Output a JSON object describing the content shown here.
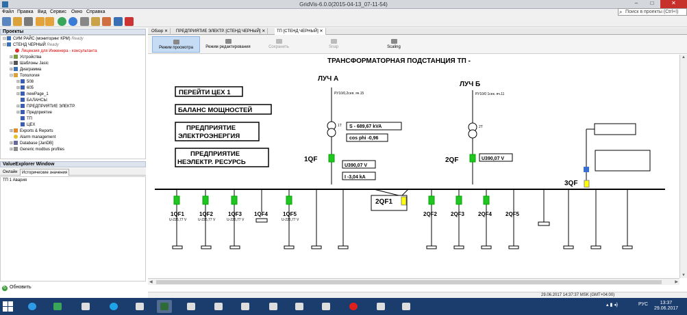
{
  "window": {
    "title": "GridVis-6.0.0(2015-04-13_07-11-54)",
    "min": "–",
    "max": "□",
    "close": "✕"
  },
  "menu": [
    "Файл",
    "Правка",
    "Вид",
    "Сервис",
    "Окно",
    "Справка"
  ],
  "search": {
    "placeholder": "Поиск в проекты (Ctrl+I)"
  },
  "projects_panel": {
    "title": "Проекты",
    "items": [
      {
        "label": "СИМ РАЙС (мониторинг КРМ)",
        "ready": "Ready",
        "level": 0,
        "color": "black"
      },
      {
        "label": "СТЕНД ЧЕРНЫЙ",
        "ready": "Ready",
        "level": 0,
        "color": "black"
      },
      {
        "label": "Лицензия для Инженера - консультанта",
        "ready": "",
        "level": 1,
        "color": "red"
      },
      {
        "label": "Устройства",
        "ready": "",
        "level": 1,
        "color": "black"
      },
      {
        "label": "Шаблоны Jasic",
        "ready": "",
        "level": 1,
        "color": "black"
      },
      {
        "label": "Диаграмма",
        "ready": "",
        "level": 1,
        "color": "black"
      },
      {
        "label": "Топология",
        "ready": "",
        "level": 1,
        "color": "black"
      },
      {
        "label": "508",
        "ready": "",
        "level": 2,
        "color": "black"
      },
      {
        "label": "605",
        "ready": "",
        "level": 2,
        "color": "black"
      },
      {
        "label": "newPage_1",
        "ready": "",
        "level": 2,
        "color": "black"
      },
      {
        "label": "БАЛАНСЫ",
        "ready": "",
        "level": 2,
        "color": "black"
      },
      {
        "label": "ПРЕДПРИЯТИЕ ЭЛЕКТР.",
        "ready": "",
        "level": 2,
        "color": "black"
      },
      {
        "label": "Предприятие",
        "ready": "",
        "level": 2,
        "color": "black"
      },
      {
        "label": "ТП",
        "ready": "",
        "level": 2,
        "color": "black"
      },
      {
        "label": "ЦЕХ",
        "ready": "",
        "level": 2,
        "color": "black"
      },
      {
        "label": "Exports & Reports",
        "ready": "",
        "level": 1,
        "color": "black"
      },
      {
        "label": "Alarm management",
        "ready": "",
        "level": 1,
        "color": "black"
      },
      {
        "label": "Database [JanDB]",
        "ready": "",
        "level": 1,
        "color": "black"
      },
      {
        "label": "Generic modbus profiles",
        "ready": "",
        "level": 1,
        "color": "black"
      }
    ]
  },
  "value_explorer": {
    "title": "ValueExplorer Window",
    "tabs": [
      "Онлайн",
      "Исторические значения"
    ],
    "row": "ТП 1 Авария",
    "refresh": "Обновить"
  },
  "doc_tabs": [
    "Обзор",
    "ПРЕДПРИЯТИЕ ЭЛЕКТР. [СТЕНД ЧЕРНЫЙ]",
    "ТП [СТЕНД ЧЕРНЫЙ]"
  ],
  "modes": [
    "Режим просмотра",
    "Режим редактирования",
    "Сохранить",
    "Snap",
    "Scaling"
  ],
  "diagram": {
    "title": "ТРАНСФОРМАТОРНАЯ ПОДСТАНЦИЯ ТП -",
    "links": [
      "ПЕРЕЙТИ ЦЕХ 1",
      "БАЛАНС МОЩНОСТЕЙ",
      "ПРЕДПРИЯТИЕ",
      "ЭЛЕКТРОЭНЕРГИЯ",
      "ПРЕДПРИЯТИЕ",
      "НЕЭЛЕКТР. РЕСУРСЬ"
    ],
    "luch_a": "ЛУЧ А",
    "luch_b": "ЛУЧ Б",
    "ru_a": "РУ10/0,2сея. яч.15",
    "ru_b": "РУ10/0 1сек. яч.11",
    "tr_a": "1Т",
    "tr_b": "2Т",
    "s_value": "S - 689,67 kVA",
    "cosphi": "cos phi -0,96",
    "qf1": "1QF",
    "qf2": "2QF",
    "qf3": "3QF",
    "u1": "U390,07 V",
    "u2": "U390,07 V",
    "i1": "I -3,04 kA",
    "sect": "2QF1",
    "feeders_left": [
      "1QF1",
      "1QF2",
      "1QF3",
      "1QF4",
      "1QF5"
    ],
    "feeders_left_u": [
      "U-226,77 V",
      "U-226,77 V",
      "U-226,77 V",
      "",
      "U-226,77 V"
    ],
    "feeders_right": [
      "2QF2",
      "2QF3",
      "2QF4",
      "2QF5"
    ]
  },
  "status": "29.06.2017 14:37:37 MSK (GMT+04:00)",
  "taskbar": {
    "lang": "РУС",
    "time": "13:37",
    "date": "29.06.2017"
  },
  "colors": {
    "accent": "#2d6ea8",
    "breaker_on": "#22c422",
    "breaker_section": "#ffff00",
    "taskbar": "#1a3d6e"
  }
}
